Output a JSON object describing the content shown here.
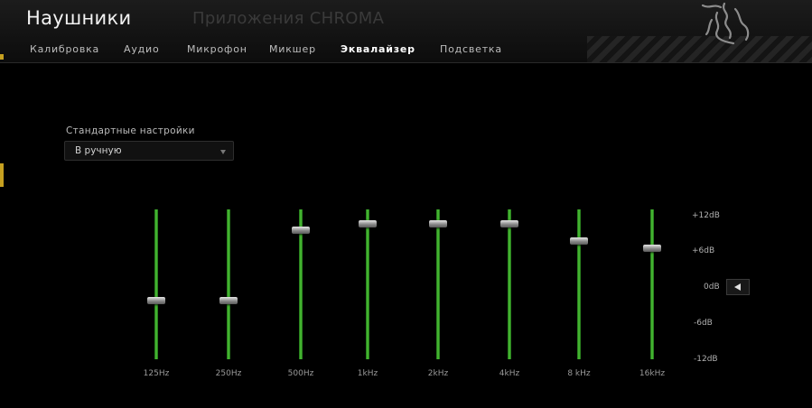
{
  "header": {
    "title": "Наушники",
    "chroma_link": "Приложения CHROMA",
    "logo_icon": "razer-snake-logo"
  },
  "tabs": [
    {
      "label": "Калибровка",
      "active": false
    },
    {
      "label": "Аудио",
      "active": false
    },
    {
      "label": "Микрофон",
      "active": false
    },
    {
      "label": "Микшер",
      "active": false
    },
    {
      "label": "Эквалайзер",
      "active": true
    },
    {
      "label": "Подсветка",
      "active": false
    }
  ],
  "preset": {
    "label": "Стандартные настройки",
    "value": "В ручную"
  },
  "equalizer": {
    "bands": [
      {
        "label": "125Hz",
        "gain_db": -2.2
      },
      {
        "label": "250Hz",
        "gain_db": -2.2
      },
      {
        "label": "500Hz",
        "gain_db": 9.6
      },
      {
        "label": "1kHz",
        "gain_db": 10.7
      },
      {
        "label": "2kHz",
        "gain_db": 10.7
      },
      {
        "label": "4kHz",
        "gain_db": 10.7
      },
      {
        "label": "8 kHz",
        "gain_db": 7.8
      },
      {
        "label": "16kHz",
        "gain_db": 6.6
      }
    ],
    "range_db": [
      -12,
      12
    ],
    "scale_labels": [
      "+12dB",
      "+6dB",
      "0dB",
      "-6dB",
      "-12dB"
    ],
    "track_color": "#3fbf2e"
  },
  "reset_button_icon": "left-arrow-icon"
}
